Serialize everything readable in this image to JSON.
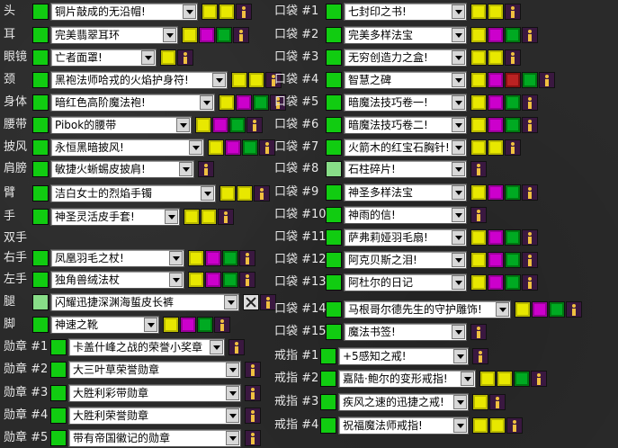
{
  "left": [
    {
      "label": "头",
      "value": "铜片敲成的无沿帽!",
      "icons": [
        "yellow-gem-icon",
        "yellow-gem-icon",
        "info-icon"
      ]
    },
    {
      "label": "耳",
      "value": "完美翡翠耳环",
      "icons": [
        "yellow-gem-icon",
        "magenta-gem-icon",
        "green-gem-icon",
        "info-icon"
      ]
    },
    {
      "label": "眼镜",
      "value": "亡者面罩!",
      "icons": [
        "yellow-gem-icon",
        "info-icon"
      ]
    },
    {
      "label": "颈",
      "value": "黑袍法师哈戎的火焰护身符!",
      "icons": [
        "yellow-gem-icon",
        "yellow-gem-icon",
        "info-icon"
      ]
    },
    {
      "label": "身体",
      "value": "暗红色高阶魔法袍!",
      "icons": [
        "yellow-gem-icon",
        "magenta-gem-icon",
        "green-gem-icon",
        "info-icon"
      ]
    },
    {
      "label": "腰带",
      "value": "Pibok的腰带",
      "icons": [
        "yellow-gem-icon",
        "magenta-gem-icon",
        "green-gem-icon",
        "info-icon"
      ]
    },
    {
      "label": "披风",
      "value": "永恒黑暗披风!",
      "icons": [
        "yellow-gem-icon",
        "magenta-gem-icon",
        "green-gem-icon",
        "info-icon"
      ]
    },
    {
      "label": "肩膀",
      "value": "敏捷火蜥蜴皮披肩!",
      "icons": [
        "info-icon"
      ]
    },
    {
      "label": "臂",
      "value": "洁白女士的烈焰手镯",
      "icons": [
        "yellow-gem-icon",
        "yellow-gem-icon",
        "info-icon"
      ]
    },
    {
      "label": "手",
      "value": "神圣灵活皮手套!",
      "icons": [
        "yellow-gem-icon",
        "yellow-gem-icon",
        "info-icon"
      ]
    },
    {
      "label": "双手",
      "value": "",
      "icons": []
    },
    {
      "label": "右手",
      "value": "凤凰羽毛之杖!",
      "icons": [
        "yellow-gem-icon",
        "magenta-gem-icon",
        "green-gem-icon",
        "info-icon"
      ]
    },
    {
      "label": "左手",
      "value": "独角兽绒法杖",
      "icons": [
        "yellow-gem-icon",
        "magenta-gem-icon",
        "green-gem-icon",
        "info-icon"
      ]
    },
    {
      "label": "腿",
      "value": "闪耀迅捷深渊海蜇皮长裤",
      "icons": [
        "empty-slot-icon",
        "info-icon"
      ]
    },
    {
      "label": "脚",
      "value": "神速之靴",
      "icons": [
        "yellow-gem-icon",
        "magenta-gem-icon",
        "green-gem-icon",
        "info-icon"
      ]
    },
    {
      "label": "勋章 #1",
      "value": "卡盖什峰之战的荣誉小奖章",
      "icons": [
        "info-icon"
      ]
    },
    {
      "label": "勋章 #2",
      "value": "大三叶草荣誉勋章",
      "icons": [
        "info-icon"
      ]
    },
    {
      "label": "勋章 #3",
      "value": "大胜利彩带勋章",
      "icons": [
        "info-icon"
      ]
    },
    {
      "label": "勋章 #4",
      "value": "大胜利荣誉勋章",
      "icons": [
        "info-icon"
      ]
    },
    {
      "label": "勋章 #5",
      "value": "带有帝国徽记的勋章",
      "icons": [
        "info-icon"
      ]
    }
  ],
  "right": [
    {
      "label": "口袋 #1",
      "value": "七封印之书!",
      "icons": [
        "yellow-gem-icon",
        "yellow-gem-icon",
        "info-icon"
      ]
    },
    {
      "label": "口袋 #2",
      "value": "完美多样法宝",
      "icons": [
        "yellow-gem-icon",
        "magenta-gem-icon",
        "green-gem-icon",
        "info-icon"
      ]
    },
    {
      "label": "口袋 #3",
      "value": "无穷创造力之盒!",
      "icons": [
        "yellow-gem-icon",
        "yellow-gem-icon",
        "info-icon"
      ]
    },
    {
      "label": "口袋 #4",
      "value": "智慧之碑",
      "icons": [
        "yellow-gem-icon",
        "magenta-gem-icon",
        "red-gem-icon",
        "green-gem-icon",
        "info-icon"
      ]
    },
    {
      "label": "口袋 #5",
      "value": "暗魔法技巧卷一!",
      "icons": [
        "yellow-gem-icon",
        "magenta-gem-icon",
        "green-gem-icon",
        "info-icon"
      ]
    },
    {
      "label": "口袋 #6",
      "value": "暗魔法技巧卷二!",
      "icons": [
        "yellow-gem-icon",
        "magenta-gem-icon",
        "green-gem-icon",
        "info-icon"
      ]
    },
    {
      "label": "口袋 #7",
      "value": "火箭木的红宝石胸针!",
      "icons": [
        "yellow-gem-icon",
        "yellow-gem-icon",
        "info-icon"
      ]
    },
    {
      "label": "口袋 #8",
      "value": "石柱碎片!",
      "icons": [
        "info-icon"
      ]
    },
    {
      "label": "口袋 #9",
      "value": "神圣多样法宝",
      "icons": [
        "yellow-gem-icon",
        "magenta-gem-icon",
        "green-gem-icon",
        "info-icon"
      ]
    },
    {
      "label": "口袋 #10",
      "value": "神雨的信!",
      "icons": [
        "info-icon"
      ]
    },
    {
      "label": "口袋 #11",
      "value": "萨弗莉娅羽毛扇!",
      "icons": [
        "yellow-gem-icon",
        "magenta-gem-icon",
        "green-gem-icon",
        "info-icon"
      ]
    },
    {
      "label": "口袋 #12",
      "value": "阿克贝斯之泪!",
      "icons": [
        "yellow-gem-icon",
        "magenta-gem-icon",
        "green-gem-icon",
        "info-icon"
      ]
    },
    {
      "label": "口袋 #13",
      "value": "阿杜尔的日记",
      "icons": [
        "yellow-gem-icon",
        "magenta-gem-icon",
        "green-gem-icon",
        "info-icon"
      ]
    },
    {
      "label": "口袋 #14",
      "value": "马根哥尔德先生的守护雕饰!",
      "icons": [
        "yellow-gem-icon",
        "magenta-gem-icon",
        "green-gem-icon",
        "info-icon"
      ]
    },
    {
      "label": "口袋 #15",
      "value": "魔法书签!",
      "icons": [
        "info-icon"
      ]
    },
    {
      "label": "戒指 #1",
      "value": "+5感知之戒!",
      "icons": [
        "info-icon"
      ]
    },
    {
      "label": "戒指 #2",
      "value": "嘉陆·鲍尔的变形戒指!",
      "icons": [
        "yellow-gem-icon",
        "yellow-gem-icon",
        "green-gem-icon",
        "info-icon"
      ]
    },
    {
      "label": "戒指 #3",
      "value": "疾风之速的迅捷之戒!",
      "icons": [
        "yellow-gem-icon",
        "info-icon"
      ]
    },
    {
      "label": "戒指 #4",
      "value": "祝福魔法师戒指!",
      "icons": [
        "yellow-gem-icon",
        "yellow-gem-icon",
        "info-icon"
      ]
    }
  ],
  "colors": {
    "checked": "#11cc11",
    "checked_light": "#88dd88",
    "gem_yellow": "#e8e800",
    "gem_magenta": "#cc00cc",
    "gem_green": "#00aa22",
    "gem_red": "#bb2222",
    "info_bg": "#3a1840"
  }
}
